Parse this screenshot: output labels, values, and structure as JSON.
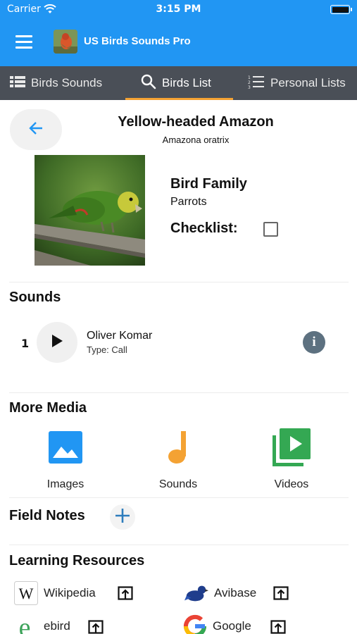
{
  "status_bar": {
    "carrier": "Carrier",
    "time": "3:15 PM"
  },
  "app": {
    "title": "US Birds Sounds Pro"
  },
  "tabs": [
    {
      "label": "Birds Sounds",
      "icon": "list-icon",
      "active": false
    },
    {
      "label": "Birds List",
      "icon": "search-icon",
      "active": true
    },
    {
      "label": "Personal Lists",
      "icon": "numbered-list-icon",
      "active": false
    }
  ],
  "bird": {
    "name": "Yellow-headed Amazon",
    "scientific_name": "Amazona oratrix",
    "family_label": "Bird Family",
    "family_value": "Parrots",
    "checklist_label": "Checklist:",
    "checklist_checked": false
  },
  "sounds": {
    "title": "Sounds",
    "items": [
      {
        "number": "1",
        "recordist": "Oliver Komar",
        "type": "Type: Call"
      }
    ]
  },
  "media": {
    "title": "More Media",
    "items": [
      {
        "label": "Images",
        "icon": "image-icon",
        "color": "#2196f3"
      },
      {
        "label": "Sounds",
        "icon": "music-note-icon",
        "color": "#f4a233"
      },
      {
        "label": "Videos",
        "icon": "video-library-icon",
        "color": "#34a853"
      }
    ]
  },
  "field_notes": {
    "title": "Field Notes"
  },
  "resources": {
    "title": "Learning Resources",
    "items": [
      {
        "label": "Wikipedia",
        "icon": "wikipedia-icon"
      },
      {
        "label": "Avibase",
        "icon": "avibase-icon"
      },
      {
        "label": "ebird",
        "icon": "ebird-icon"
      },
      {
        "label": "Google",
        "icon": "google-icon"
      }
    ]
  },
  "colors": {
    "app_bar": "#2196f3",
    "tab_bar": "#4a4f57",
    "tab_indicator": "#f4a233",
    "info_button": "#5d7180"
  }
}
